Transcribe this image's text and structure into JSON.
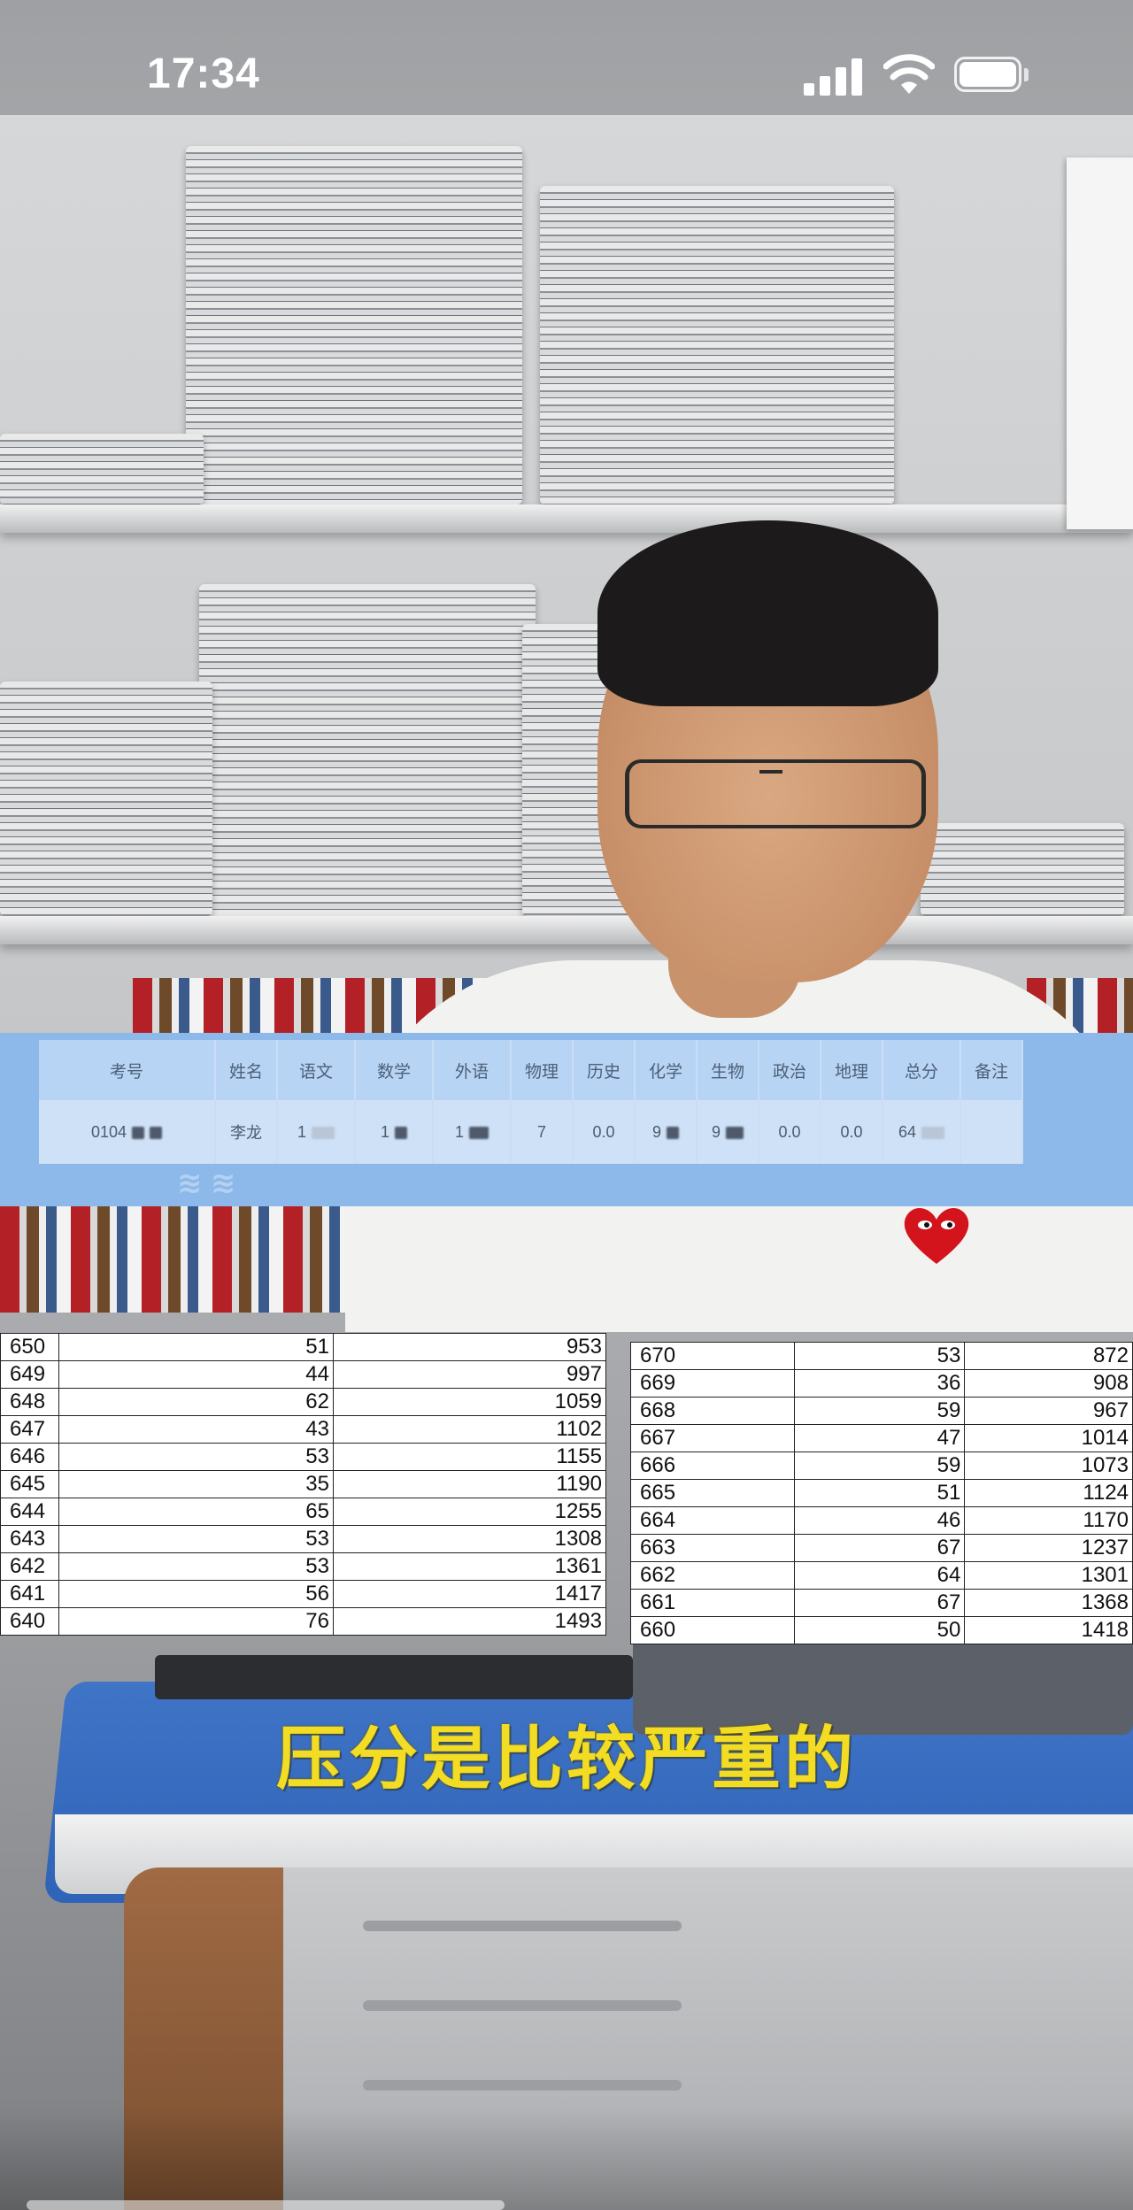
{
  "status_bar": {
    "time": "17:34",
    "icons": [
      "signal-icon",
      "wifi-icon",
      "battery-icon"
    ]
  },
  "score_card": {
    "headers": [
      "考号",
      "姓名",
      "语文",
      "数学",
      "外语",
      "物理",
      "历史",
      "化学",
      "生物",
      "政治",
      "地理",
      "总分",
      "备注"
    ],
    "row": [
      "0104",
      "李龙",
      "1",
      "1",
      "1",
      "7",
      "0.0",
      "9",
      "9",
      "0.0",
      "0.0",
      "64",
      ""
    ],
    "colors": {
      "panel": "#8cb8ea",
      "header": "#b7d4f4",
      "cell": "#cfe1f6"
    }
  },
  "rank_left": [
    [
      "650",
      "51",
      "953"
    ],
    [
      "649",
      "44",
      "997"
    ],
    [
      "648",
      "62",
      "1059"
    ],
    [
      "647",
      "43",
      "1102"
    ],
    [
      "646",
      "53",
      "1155"
    ],
    [
      "645",
      "35",
      "1190"
    ],
    [
      "644",
      "65",
      "1255"
    ],
    [
      "643",
      "53",
      "1308"
    ],
    [
      "642",
      "53",
      "1361"
    ],
    [
      "641",
      "56",
      "1417"
    ],
    [
      "640",
      "76",
      "1493"
    ]
  ],
  "rank_right": [
    [
      "670",
      "53",
      "872"
    ],
    [
      "669",
      "36",
      "908"
    ],
    [
      "668",
      "59",
      "967"
    ],
    [
      "667",
      "47",
      "1014"
    ],
    [
      "666",
      "59",
      "1073"
    ],
    [
      "665",
      "51",
      "1124"
    ],
    [
      "664",
      "46",
      "1170"
    ],
    [
      "663",
      "67",
      "1237"
    ],
    [
      "662",
      "64",
      "1301"
    ],
    [
      "661",
      "67",
      "1368"
    ],
    [
      "660",
      "50",
      "1418"
    ]
  ],
  "caption": {
    "text": "压分是比较严重的",
    "color": "#f2dc24"
  }
}
